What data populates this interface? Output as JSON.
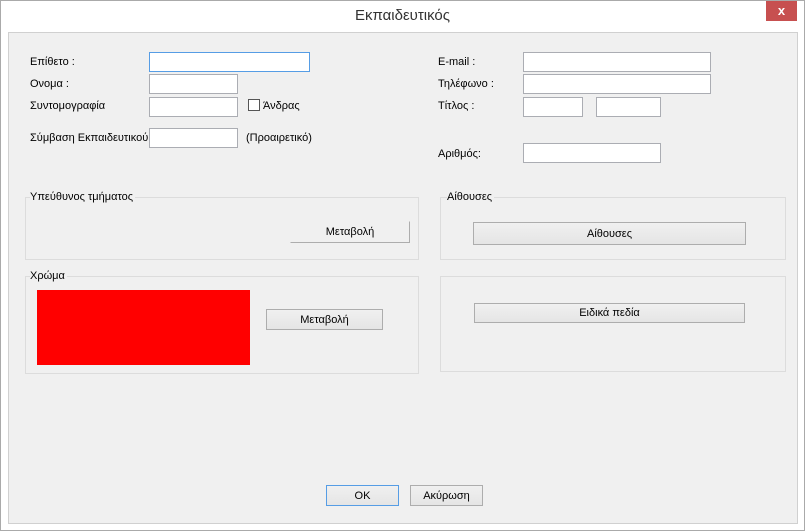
{
  "window": {
    "title": "Εκπαιδευτικός",
    "close_label": "x"
  },
  "left": {
    "surname_label": "Επίθετο :",
    "name_label": "Ονομα :",
    "abbrev_label": "Συντομογραφία",
    "male_label": "Άνδρας",
    "male_checked": false,
    "contract_label": "Σύμβαση Εκπαιδευτικού",
    "optional_label": "(Προαιρετικό)"
  },
  "right": {
    "email_label": "E-mail :",
    "phone_label": "Τηλέφωνο :",
    "title_label": "Τίτλος :",
    "number_label": "Αριθμός:"
  },
  "groups": {
    "head_title": "Υπεύθυνος τμήματος",
    "head_button": "Μεταβολή",
    "rooms_title": "Αίθουσες",
    "rooms_button": "Αίθουσες",
    "color_title": "Χρώμα",
    "color_button": "Μεταβολή",
    "color_value": "#ff0000",
    "special_button": "Ειδικά πεδία"
  },
  "footer": {
    "ok": "OK",
    "cancel": "Ακύρωση"
  }
}
